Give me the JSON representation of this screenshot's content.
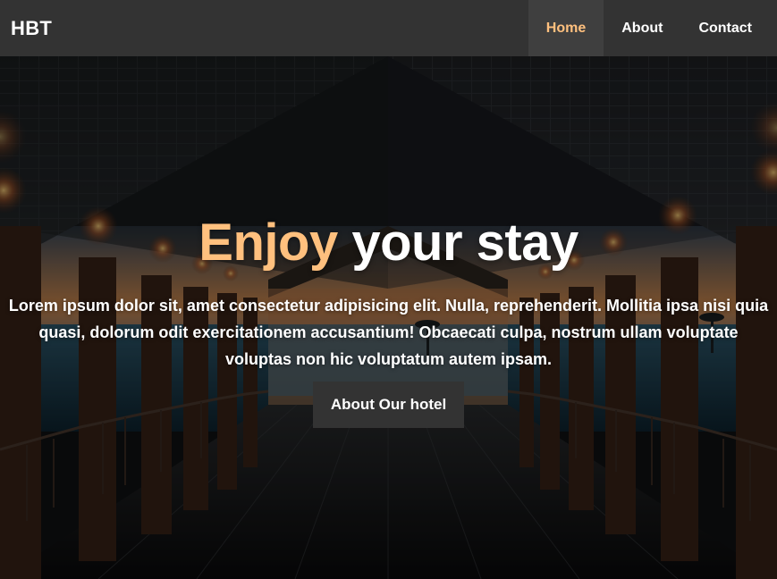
{
  "brand": "HBT",
  "nav": {
    "items": [
      {
        "label": "Home",
        "active": true
      },
      {
        "label": "About",
        "active": false
      },
      {
        "label": "Contact",
        "active": false
      }
    ]
  },
  "hero": {
    "title_accent": "Enjoy",
    "title_rest": "your stay",
    "text": "Lorem ipsum dolor sit, amet consectetur adipisicing elit. Nulla, reprehenderit. Mollitia ipsa nisi quia quasi, dolorum odit exercitationem accusantium! Obcaecati culpa, nostrum ullam voluptate voluptas non hic voluptatum autem ipsam.",
    "button_label": "About Our hotel"
  },
  "colors": {
    "navbar": "#333333",
    "active_nav": "#3f3f3f",
    "accent": "#ffc07e",
    "button": "#333333"
  },
  "icons": {
    "background": "pier-walkway-sunset-photo"
  }
}
